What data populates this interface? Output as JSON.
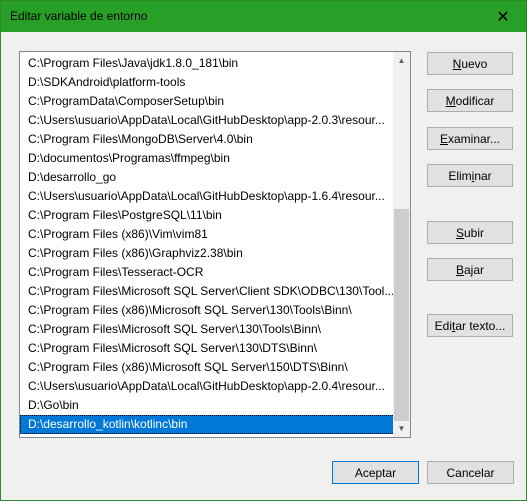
{
  "window": {
    "title": "Editar variable de entorno",
    "close_glyph": "✕"
  },
  "list": {
    "items": [
      "C:\\Program Files\\Java\\jdk1.8.0_181\\bin",
      "D:\\SDKAndroid\\platform-tools",
      "C:\\ProgramData\\ComposerSetup\\bin",
      "C:\\Users\\usuario\\AppData\\Local\\GitHubDesktop\\app-2.0.3\\resour...",
      "C:\\Program Files\\MongoDB\\Server\\4.0\\bin",
      "D:\\documentos\\Programas\\ffmpeg\\bin",
      "D:\\desarrollo_go",
      "C:\\Users\\usuario\\AppData\\Local\\GitHubDesktop\\app-1.6.4\\resour...",
      "C:\\Program Files\\PostgreSQL\\11\\bin",
      "C:\\Program Files (x86)\\Vim\\vim81",
      "C:\\Program Files (x86)\\Graphviz2.38\\bin",
      "C:\\Program Files\\Tesseract-OCR",
      "C:\\Program Files\\Microsoft SQL Server\\Client SDK\\ODBC\\130\\Tool...",
      "C:\\Program Files (x86)\\Microsoft SQL Server\\130\\Tools\\Binn\\",
      "C:\\Program Files\\Microsoft SQL Server\\130\\Tools\\Binn\\",
      "C:\\Program Files\\Microsoft SQL Server\\130\\DTS\\Binn\\",
      "C:\\Program Files (x86)\\Microsoft SQL Server\\150\\DTS\\Binn\\",
      "C:\\Users\\usuario\\AppData\\Local\\GitHubDesktop\\app-2.0.4\\resour...",
      "D:\\Go\\bin",
      "D:\\desarrollo_kotlin\\kotlinc\\bin"
    ],
    "selected_index": 19
  },
  "buttons": {
    "nuevo": {
      "pre": "",
      "key": "N",
      "post": "uevo"
    },
    "modificar": {
      "pre": "",
      "key": "M",
      "post": "odificar"
    },
    "examinar": {
      "pre": "",
      "key": "E",
      "post": "xaminar..."
    },
    "eliminar": {
      "pre": "Elim",
      "key": "i",
      "post": "nar"
    },
    "subir": {
      "pre": "",
      "key": "S",
      "post": "ubir"
    },
    "bajar": {
      "pre": "",
      "key": "B",
      "post": "ajar"
    },
    "editar_texto": {
      "pre": "Edi",
      "key": "t",
      "post": "ar texto..."
    },
    "aceptar": "Aceptar",
    "cancelar": "Cancelar"
  },
  "colors": {
    "titlebar": "#28a028",
    "selection": "#0078d7"
  }
}
